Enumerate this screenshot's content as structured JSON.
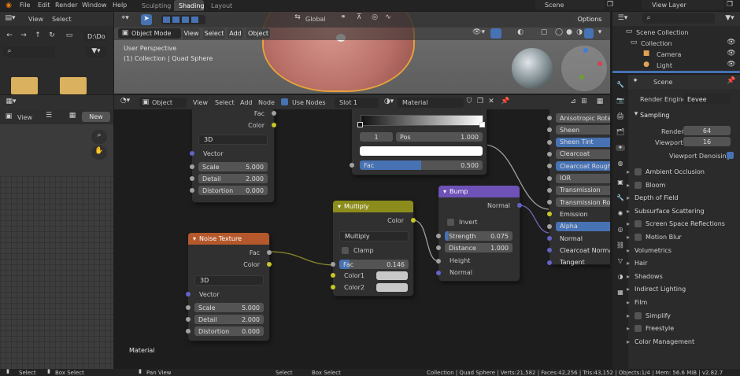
{
  "topbar": {
    "menus": [
      "File",
      "Edit",
      "Render",
      "Window",
      "Help"
    ],
    "workspace_tabs": [
      "Sculpting",
      "Shading",
      "Layout"
    ],
    "scene": "Scene",
    "view_layer": "View Layer"
  },
  "filebrowser": {
    "menus": [
      "View",
      "Select"
    ],
    "path_field": "D:\\Do"
  },
  "image_editor": {
    "view_label": "View",
    "new_label": "New"
  },
  "viewport": {
    "mode": "Object Mode",
    "menus": [
      "View",
      "Select",
      "Add",
      "Object"
    ],
    "transform": "Global",
    "options": "Options",
    "overlay_title": "User Perspective",
    "overlay_sub": "(1) Collection | Quad Sphere"
  },
  "node_header": {
    "type": "Object",
    "menus": [
      "View",
      "Select",
      "Add",
      "Node"
    ],
    "use_nodes": "Use Nodes",
    "slot": "Slot 1",
    "material": "Material"
  },
  "nodes": {
    "noise_top": {
      "out": [
        "Fac",
        "Color"
      ],
      "dim": "3D",
      "vector": "Vector",
      "scale_l": "Scale",
      "scale_v": "5.000",
      "detail_l": "Detail",
      "detail_v": "2.000",
      "distortion_l": "Distortion",
      "distortion_v": "0.000"
    },
    "ramp": {
      "idx": "1",
      "pos_l": "Pos",
      "pos_v": "1.000",
      "fac_l": "Fac",
      "fac_v": "0.500"
    },
    "noise": {
      "title": "Noise Texture",
      "out": [
        "Fac",
        "Color"
      ],
      "dim": "3D",
      "vector": "Vector",
      "scale_l": "Scale",
      "scale_v": "5.000",
      "detail_l": "Detail",
      "detail_v": "2.000",
      "distortion_l": "Distortion",
      "distortion_v": "0.000"
    },
    "multiply": {
      "title": "Multiply",
      "out": "Color",
      "op": "Multiply",
      "clamp": "Clamp",
      "fac_l": "Fac",
      "fac_v": "0.146",
      "c1": "Color1",
      "c2": "Color2"
    },
    "bump": {
      "title": "Bump",
      "out": "Normal",
      "invert": "Invert",
      "strength_l": "Strength",
      "strength_v": "0.075",
      "distance_l": "Distance",
      "distance_v": "1.000",
      "height": "Height",
      "normal": "Normal"
    },
    "bsdf": [
      "Anisotropic Rotati",
      "Sheen",
      "Sheen Tint",
      "Clearcoat",
      "Clearcoat Roughne",
      "IOR",
      "Transmission",
      "Transmission Roug",
      "Emission",
      "Alpha",
      "Normal",
      "Clearcoat Normal",
      "Tangent"
    ]
  },
  "node_editor_label": "Material",
  "outliner": {
    "items": [
      "Scene Collection",
      "Collection",
      "Camera",
      "Light"
    ]
  },
  "properties": {
    "scene": "Scene",
    "render_engine_l": "Render Engine",
    "render_engine": "Eevee",
    "sampling": "Sampling",
    "render_l": "Render",
    "render_v": "64",
    "viewport_l": "Viewport",
    "viewport_v": "16",
    "denoise": "Viewport Denoising",
    "panels": [
      "Ambient Occlusion",
      "Bloom",
      "Depth of Field",
      "Subsurface Scattering",
      "Screen Space Reflections",
      "Motion Blur",
      "Volumetrics",
      "Hair",
      "Shadows",
      "Indirect Lighting",
      "Film",
      "Simplify",
      "Freestyle",
      "Color Management"
    ]
  },
  "status": {
    "left1": "Select",
    "left2": "Box Select",
    "mid1": "Pan View",
    "mid2": "Select",
    "mid3": "Box Select",
    "stats": "Collection | Quad Sphere | Verts:21,582 | Faces:42,256 | Tris:43,152 | Objects:1/4 | Mem: 56.6 MiB | v2.82.7"
  },
  "colors": {
    "accent": "#4772b3",
    "texture_header": "#b5582b",
    "converter_header": "#8c8c1c",
    "vector_header": "#6e52b7",
    "socket_yellow": "#c7c729",
    "socket_purple": "#6363c7"
  }
}
